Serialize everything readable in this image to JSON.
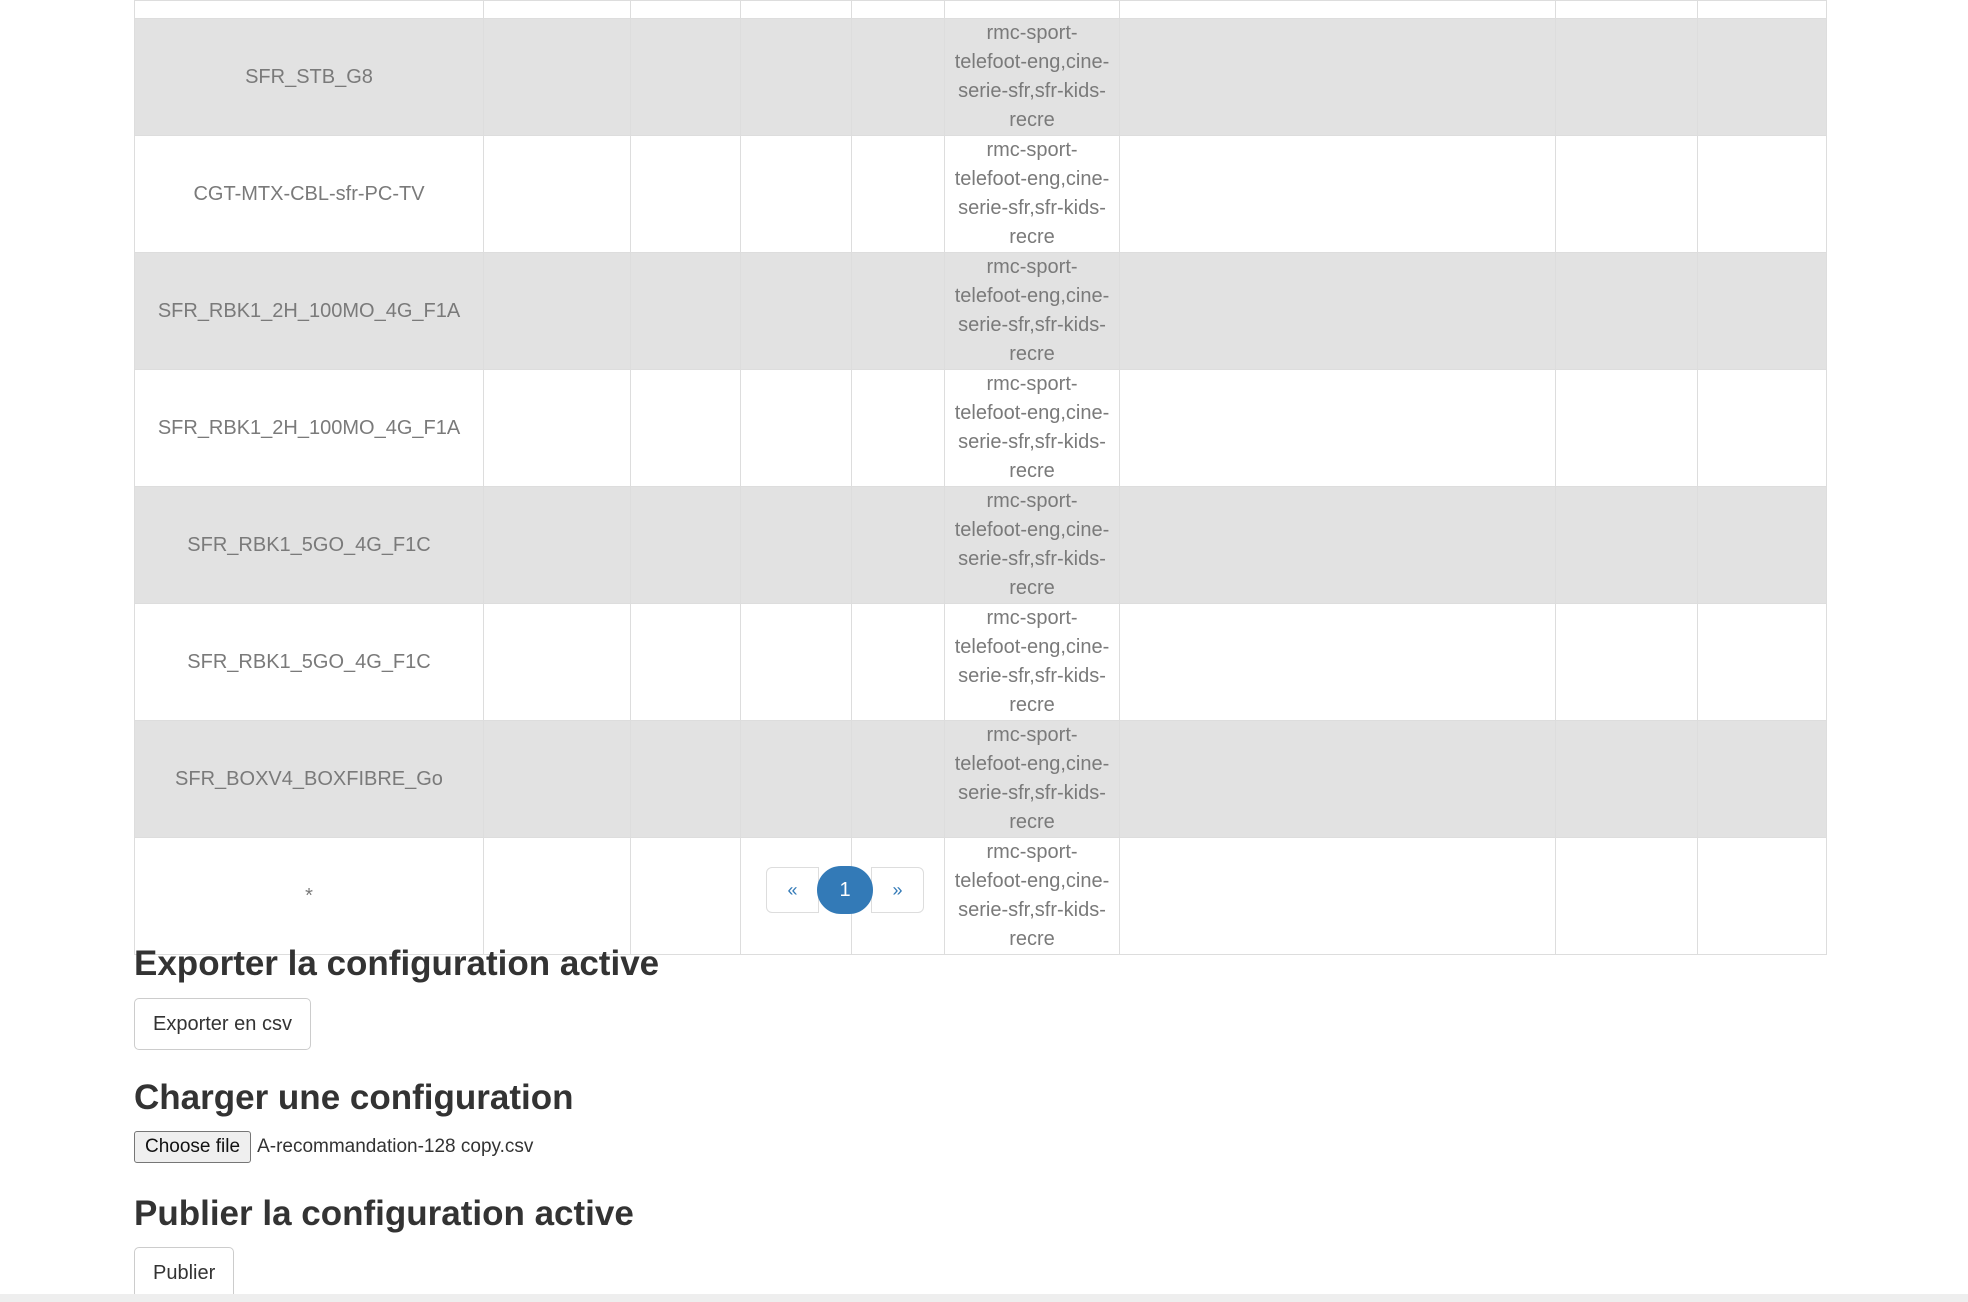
{
  "table": {
    "rows": [
      [
        "",
        "",
        "",
        "",
        "",
        "",
        "",
        ""
      ],
      [
        "SFR_STB_G8",
        "",
        "",
        "",
        "",
        "rmc-sport-telefoot-eng,cine-serie-sfr,sfr-kids-recre",
        "",
        ""
      ],
      [
        "CGT-MTX-CBL-sfr-PC-TV",
        "",
        "",
        "",
        "",
        "rmc-sport-telefoot-eng,cine-serie-sfr,sfr-kids-recre",
        "",
        ""
      ],
      [
        "SFR_RBK1_2H_100MO_4G_F1A",
        "",
        "",
        "",
        "",
        "rmc-sport-telefoot-eng,cine-serie-sfr,sfr-kids-recre",
        "",
        ""
      ],
      [
        "SFR_RBK1_2H_100MO_4G_F1A",
        "",
        "",
        "",
        "",
        "rmc-sport-telefoot-eng,cine-serie-sfr,sfr-kids-recre",
        "",
        ""
      ],
      [
        "SFR_RBK1_5GO_4G_F1C",
        "",
        "",
        "",
        "",
        "rmc-sport-telefoot-eng,cine-serie-sfr,sfr-kids-recre",
        "",
        ""
      ],
      [
        "SFR_RBK1_5GO_4G_F1C",
        "",
        "",
        "",
        "",
        "rmc-sport-telefoot-eng,cine-serie-sfr,sfr-kids-recre",
        "",
        ""
      ],
      [
        "SFR_BOXV4_BOXFIBRE_Go",
        "",
        "",
        "",
        "",
        "rmc-sport-telefoot-eng,cine-serie-sfr,sfr-kids-recre",
        "",
        ""
      ],
      [
        "*",
        "",
        "",
        "",
        "",
        "rmc-sport-telefoot-eng,cine-serie-sfr,sfr-kids-recre",
        "",
        ""
      ]
    ]
  },
  "pagination": {
    "prev": "«",
    "current": "1",
    "next": "»"
  },
  "export": {
    "heading": "Exporter la configuration active",
    "button": "Exporter en csv"
  },
  "load": {
    "heading": "Charger une configuration",
    "file_button": "Choose file",
    "file_name": "A-recommandation-128 copy.csv"
  },
  "publish": {
    "heading": "Publier la configuration active",
    "button": "Publier"
  }
}
